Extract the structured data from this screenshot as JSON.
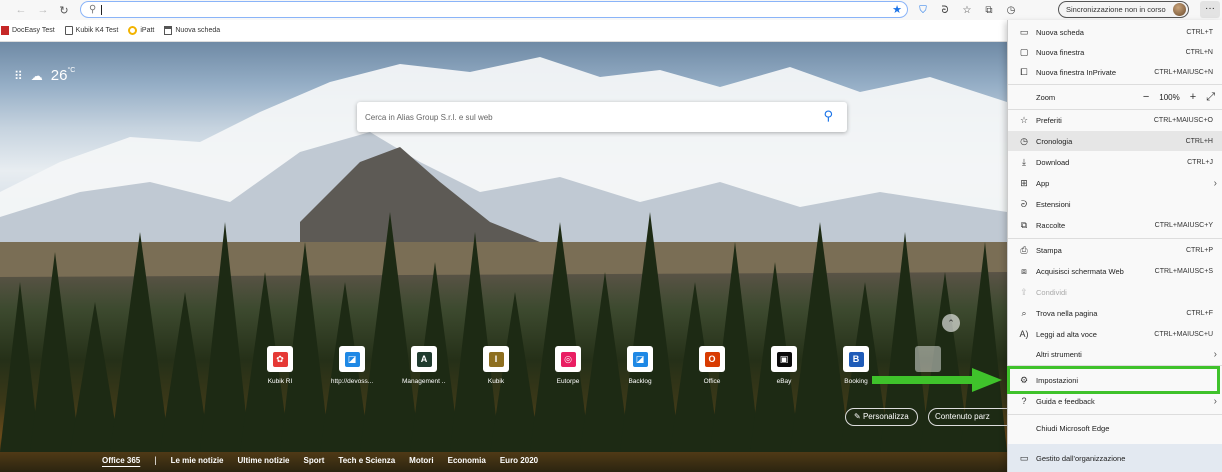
{
  "toolbar": {
    "back_icon": "back-arrow-icon",
    "address_value": "",
    "sync_label": "Sincronizzazione non in corso",
    "more_label": "···"
  },
  "bookmarks": [
    {
      "label": "DocEasy Test",
      "icon": "red-square-icon"
    },
    {
      "label": "Kubik K4 Test",
      "icon": "page-icon"
    },
    {
      "label": "iPatt",
      "icon": "ring-icon"
    },
    {
      "label": "Nuova scheda",
      "icon": "tab-icon"
    }
  ],
  "weather": {
    "temp": "26",
    "unit": "°C"
  },
  "search": {
    "placeholder": "Cerca in Alias Group S.r.l. e sul web"
  },
  "tiles": [
    {
      "label": "Kubik RI",
      "color": "#e53935",
      "glyph": "✿"
    },
    {
      "label": "http://devoss...",
      "color": "#1e88e5",
      "glyph": "◪"
    },
    {
      "label": "Management ...",
      "color": "#1f3b2e",
      "glyph": "A"
    },
    {
      "label": "Kubik",
      "color": "#8d6e1e",
      "glyph": "I"
    },
    {
      "label": "Eutorpe",
      "color": "#e91e63",
      "glyph": "◎"
    },
    {
      "label": "Backlog",
      "color": "#1e88e5",
      "glyph": "◪"
    },
    {
      "label": "Office",
      "color": "#d83b01",
      "glyph": "O"
    },
    {
      "label": "eBay",
      "color": "#0a0a0a",
      "glyph": "▣"
    },
    {
      "label": "Booking",
      "color": "#1e5bb8",
      "glyph": "B"
    }
  ],
  "news": {
    "tabs": [
      "Office 365",
      "Le mie notizie",
      "Ultime notizie",
      "Sport",
      "Tech e Scienza",
      "Motori",
      "Economia",
      "Euro 2020"
    ],
    "separator": "|",
    "personalize": "Personalizza",
    "content": "Contenuto parz"
  },
  "menu": {
    "zoom_label": "Zoom",
    "zoom_value": "100%",
    "items": [
      {
        "label": "Nuova scheda",
        "shortcut": "CTRL+T",
        "icon": "new-tab-icon"
      },
      {
        "label": "Nuova finestra",
        "shortcut": "CTRL+N",
        "icon": "new-window-icon"
      },
      {
        "label": "Nuova finestra InPrivate",
        "shortcut": "CTRL+MAIUSC+N",
        "icon": "inprivate-icon"
      },
      {
        "label": "Preferiti",
        "shortcut": "CTRL+MAIUSC+O",
        "icon": "favorites-icon"
      },
      {
        "label": "Cronologia",
        "shortcut": "CTRL+H",
        "icon": "history-icon"
      },
      {
        "label": "Download",
        "shortcut": "CTRL+J",
        "icon": "download-icon"
      },
      {
        "label": "App",
        "shortcut": "",
        "icon": "apps-icon"
      },
      {
        "label": "Estensioni",
        "shortcut": "",
        "icon": "extensions-icon"
      },
      {
        "label": "Raccolte",
        "shortcut": "CTRL+MAIUSC+Y",
        "icon": "collections-icon"
      },
      {
        "label": "Stampa",
        "shortcut": "CTRL+P",
        "icon": "print-icon"
      },
      {
        "label": "Acquisisci schermata Web",
        "shortcut": "CTRL+MAIUSC+S",
        "icon": "web-capture-icon"
      },
      {
        "label": "Condividi",
        "shortcut": "",
        "icon": "share-icon"
      },
      {
        "label": "Trova nella pagina",
        "shortcut": "CTRL+F",
        "icon": "find-icon"
      },
      {
        "label": "Leggi ad alta voce",
        "shortcut": "CTRL+MAIUSC+U",
        "icon": "read-aloud-icon"
      },
      {
        "label": "Altri strumenti",
        "shortcut": "",
        "icon": ""
      },
      {
        "label": "Impostazioni",
        "shortcut": "",
        "icon": "settings-icon"
      },
      {
        "label": "Guida e feedback",
        "shortcut": "",
        "icon": "help-icon"
      },
      {
        "label": "Chiudi Microsoft Edge",
        "shortcut": "",
        "icon": ""
      }
    ],
    "managed": "Gestito dall'organizzazione"
  },
  "colors": {
    "highlight": "#3fc22b",
    "accent": "#1a73e8"
  }
}
